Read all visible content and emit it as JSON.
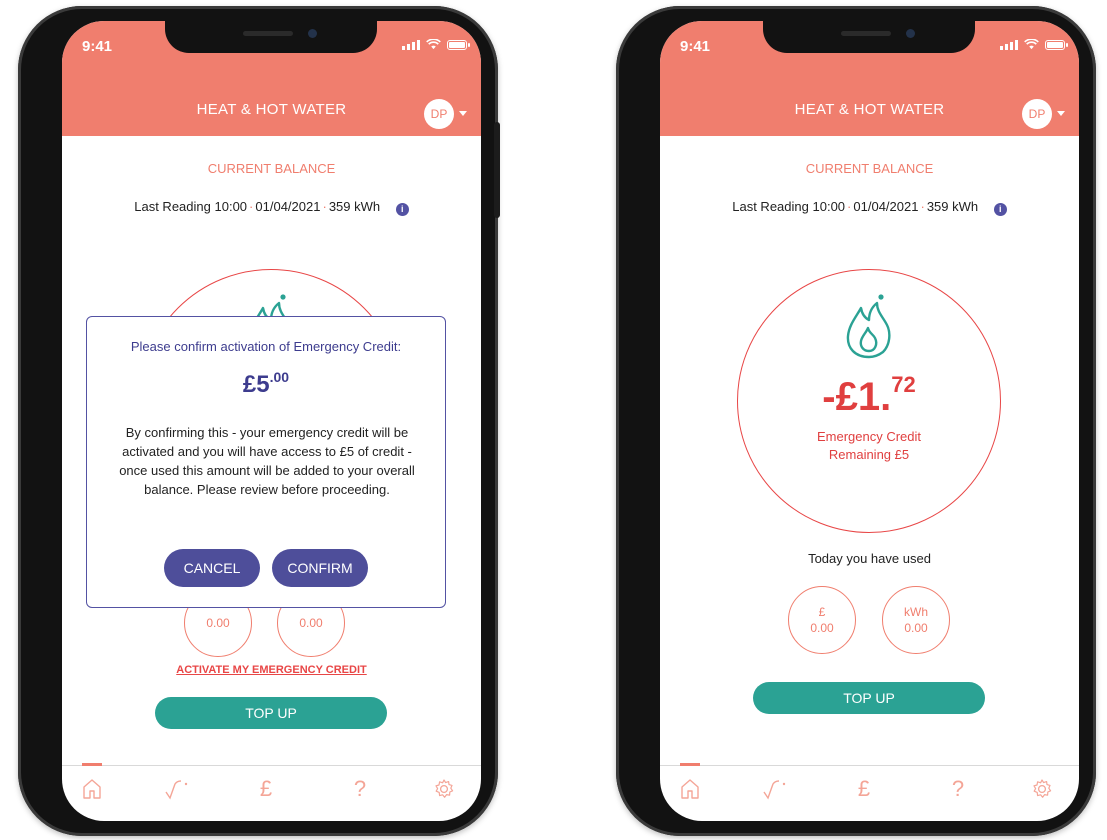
{
  "status_bar": {
    "time": "9:41"
  },
  "header": {
    "title": "HEAT & HOT WATER",
    "avatar_initials": "DP"
  },
  "balance": {
    "section_label": "CURRENT BALANCE",
    "last_reading_label": "Last Reading",
    "reading_time": "10:00",
    "reading_date": "01/04/2021",
    "reading_kwh": "359 kWh",
    "separator": "·",
    "info_icon_glyph": "i",
    "amount_main": "-£1.",
    "amount_pence": "72",
    "credit_line_1": "Emergency Credit",
    "credit_line_2": "Remaining £5"
  },
  "usage": {
    "label": "Today you have used",
    "cost_unit": "£",
    "cost_value": "0.00",
    "energy_unit": "kWh",
    "energy_value": "0.00"
  },
  "actions": {
    "emergency_link": "ACTIVATE MY EMERGENCY CREDIT",
    "topup_label": "TOP UP"
  },
  "modal": {
    "title": "Please confirm activation of Emergency Credit:",
    "amount_main": "£5",
    "amount_pence": ".00",
    "body": "By confirming this - your emergency credit will be activated and you will have access to £5 of credit - once used this amount will be added to your overall balance. Please review before proceeding.",
    "cancel_label": "CANCEL",
    "confirm_label": "CONFIRM"
  },
  "tab_bar": {
    "items": [
      {
        "icon": "home-icon"
      },
      {
        "icon": "usage-graph-icon"
      },
      {
        "icon": "pound-icon",
        "glyph": "£"
      },
      {
        "icon": "help-icon",
        "glyph": "?"
      },
      {
        "icon": "settings-icon"
      }
    ]
  },
  "colors": {
    "brand_coral": "#f07e6e",
    "alert_red": "#e03f3f",
    "teal": "#2ba294",
    "modal_purple": "#4e4e9a"
  }
}
